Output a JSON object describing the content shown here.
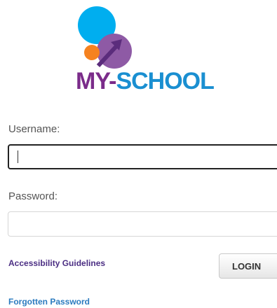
{
  "logo": {
    "text": "MY-SCHOOL"
  },
  "form": {
    "username_label": "Username:",
    "username_value": "",
    "password_label": "Password:",
    "password_value": ""
  },
  "links": {
    "accessibility": "Accessibility Guidelines",
    "forgotten": "Forgotten Password"
  },
  "login_button": "LOGIN",
  "colors": {
    "blue": "#00aeef",
    "orange": "#f58220",
    "purple": "#8e5aa5",
    "brand_purple": "#7b2c8a",
    "brand_blue": "#1a8fd1",
    "accessibility_link": "#4b2e83",
    "forgotten_link": "#2b7bbf"
  }
}
